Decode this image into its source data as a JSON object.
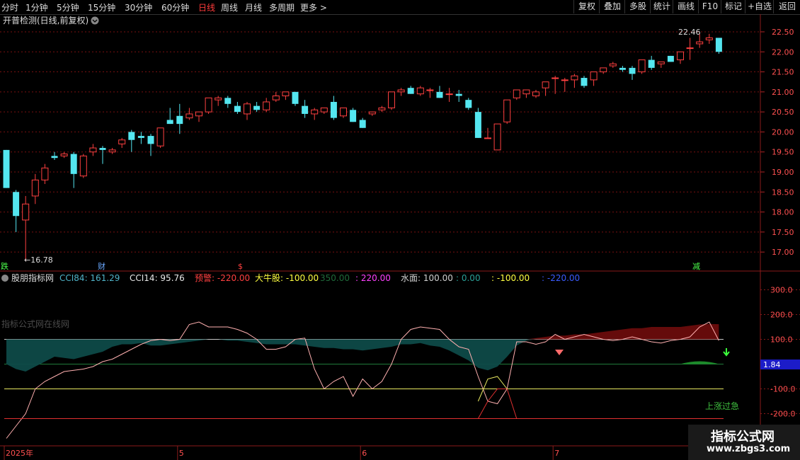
{
  "toolbar": {
    "tabs": [
      "分时",
      "1分钟",
      "5分钟",
      "15分钟",
      "30分钟",
      "60分钟",
      "日线",
      "周线",
      "月线",
      "多周期",
      "更多 >"
    ],
    "active_tab": "日线",
    "right_buttons": [
      "复权",
      "叠加",
      "多股",
      "统计",
      "画线",
      "F10",
      "标记",
      "+自选",
      "返回"
    ]
  },
  "main_panel": {
    "title": "开普检测(日线,前复权)",
    "high_label": "22.46",
    "low_label": "←16.78",
    "markers": {
      "die": "跌",
      "cai": "财",
      "dollar": "$",
      "jian": "减"
    }
  },
  "indicator_panel": {
    "name": "股朋指标网",
    "items": [
      {
        "text": "CCI84: 161.29",
        "color": "#4fb3c8"
      },
      {
        "text": "CCI14: 95.76",
        "color": "#e8e8e8"
      },
      {
        "text": "预警: -220.00",
        "color": "#ff4040"
      },
      {
        "text": "大牛股: -100.00",
        "color": "#ffff40"
      },
      {
        "text": "350.00",
        "color": "#1f6b3a"
      },
      {
        "text": ": 220.00",
        "color": "#ff40ff"
      },
      {
        "text": "水面: 100.00",
        "color": "#d0d0d0"
      },
      {
        "text": ": 0.00",
        "color": "#2aa198"
      },
      {
        "text": ": -100.00",
        "color": "#ffff40"
      },
      {
        "text": ": -220.00",
        "color": "#3a5cff"
      }
    ],
    "site_watermark": "指标公式网在线网",
    "up_text": "上涨过急",
    "value_box": "1.84"
  },
  "watermark": {
    "line1": "指标公式网",
    "line2": "www.zbgs3.com"
  },
  "colors": {
    "up": "#ff4040",
    "down": "#54e6f0",
    "bg": "#000000",
    "grid": "#7a1010"
  },
  "chart_data": {
    "type": "candlestick",
    "price_axis": {
      "ticks": [
        17.0,
        17.5,
        18.0,
        18.5,
        19.0,
        19.5,
        20.0,
        20.5,
        21.0,
        21.5,
        22.0,
        22.5
      ],
      "range": [
        16.72,
        22.8
      ]
    },
    "indicator_axis": {
      "ticks": [
        300,
        200,
        100,
        0,
        -100,
        -200
      ],
      "labels": [
        "300.0",
        "200.0",
        "100.0",
        "0.00",
        "-100.0",
        "-200.0"
      ],
      "range": [
        -330,
        370
      ]
    },
    "date_labels": [
      {
        "label": "2025年",
        "index": 0
      },
      {
        "label": "5",
        "index": 18
      },
      {
        "label": "6",
        "index": 37
      },
      {
        "label": "7",
        "index": 57
      }
    ],
    "candles": [
      [
        19.55,
        19.55,
        18.6,
        18.6
      ],
      [
        18.5,
        18.55,
        17.5,
        17.9
      ],
      [
        17.8,
        18.4,
        16.78,
        18.2
      ],
      [
        18.4,
        18.95,
        18.2,
        18.8
      ],
      [
        18.8,
        19.2,
        18.7,
        19.1
      ],
      [
        19.4,
        19.5,
        19.3,
        19.35
      ],
      [
        19.4,
        19.5,
        19.35,
        19.45
      ],
      [
        19.45,
        19.5,
        18.6,
        18.95
      ],
      [
        18.9,
        19.45,
        18.85,
        19.4
      ],
      [
        19.5,
        19.7,
        19.4,
        19.6
      ],
      [
        19.6,
        19.65,
        19.2,
        19.55
      ],
      [
        19.5,
        19.6,
        19.45,
        19.55
      ],
      [
        19.7,
        19.85,
        19.6,
        19.8
      ],
      [
        20.0,
        20.05,
        19.5,
        19.8
      ],
      [
        19.9,
        20.0,
        19.7,
        19.85
      ],
      [
        19.9,
        19.95,
        19.4,
        19.7
      ],
      [
        19.65,
        20.1,
        19.6,
        20.1
      ],
      [
        20.3,
        20.6,
        20.2,
        20.2
      ],
      [
        20.4,
        20.7,
        19.95,
        20.2
      ],
      [
        20.35,
        20.6,
        20.3,
        20.45
      ],
      [
        20.4,
        20.5,
        20.25,
        20.5
      ],
      [
        20.5,
        20.85,
        20.45,
        20.85
      ],
      [
        20.8,
        20.9,
        20.65,
        20.85
      ],
      [
        20.85,
        20.9,
        20.6,
        20.7
      ],
      [
        20.65,
        20.75,
        20.45,
        20.5
      ],
      [
        20.45,
        20.75,
        20.3,
        20.7
      ],
      [
        20.65,
        20.75,
        20.5,
        20.55
      ],
      [
        20.55,
        20.85,
        20.5,
        20.75
      ],
      [
        20.8,
        21.0,
        20.75,
        20.9
      ],
      [
        20.9,
        21.0,
        20.8,
        21.0
      ],
      [
        21.0,
        21.0,
        20.65,
        20.7
      ],
      [
        20.65,
        20.8,
        20.35,
        20.45
      ],
      [
        20.45,
        20.6,
        20.3,
        20.55
      ],
      [
        20.5,
        20.6,
        20.45,
        20.6
      ],
      [
        20.75,
        20.9,
        20.3,
        20.35
      ],
      [
        20.4,
        20.6,
        20.35,
        20.6
      ],
      [
        20.55,
        20.6,
        20.25,
        20.25
      ],
      [
        20.3,
        20.35,
        20.1,
        20.1
      ],
      [
        20.45,
        20.5,
        20.4,
        20.5
      ],
      [
        20.55,
        20.65,
        20.5,
        20.6
      ],
      [
        20.6,
        21.0,
        20.55,
        21.0
      ],
      [
        21.0,
        21.1,
        20.9,
        21.05
      ],
      [
        21.1,
        21.15,
        20.95,
        20.95
      ],
      [
        20.95,
        21.15,
        20.9,
        21.1
      ],
      [
        21.05,
        21.1,
        20.85,
        21.05
      ],
      [
        21.0,
        21.15,
        20.85,
        20.85
      ],
      [
        20.95,
        21.1,
        20.75,
        20.95
      ],
      [
        20.95,
        21.05,
        20.75,
        20.9
      ],
      [
        20.8,
        20.85,
        20.55,
        20.6
      ],
      [
        20.5,
        20.6,
        19.85,
        19.85
      ],
      [
        19.85,
        20.1,
        19.85,
        19.85
      ],
      [
        19.55,
        20.2,
        19.55,
        20.2
      ],
      [
        20.25,
        20.8,
        20.2,
        20.8
      ],
      [
        20.85,
        21.05,
        20.8,
        21.05
      ],
      [
        20.95,
        21.05,
        20.85,
        21.05
      ],
      [
        20.9,
        21.05,
        20.85,
        21.0
      ],
      [
        21.1,
        21.25,
        20.9,
        21.25
      ],
      [
        21.35,
        21.4,
        20.95,
        21.35
      ],
      [
        21.3,
        21.35,
        21.0,
        21.3
      ],
      [
        21.3,
        21.45,
        21.1,
        21.4
      ],
      [
        21.35,
        21.4,
        21.1,
        21.15
      ],
      [
        21.3,
        21.5,
        21.15,
        21.5
      ],
      [
        21.5,
        21.6,
        21.45,
        21.6
      ],
      [
        21.65,
        21.75,
        21.6,
        21.7
      ],
      [
        21.6,
        21.65,
        21.5,
        21.55
      ],
      [
        21.6,
        21.65,
        21.3,
        21.45
      ],
      [
        21.5,
        21.8,
        21.45,
        21.8
      ],
      [
        21.8,
        21.9,
        21.55,
        21.6
      ],
      [
        21.7,
        21.75,
        21.6,
        21.75
      ],
      [
        21.9,
        21.9,
        21.75,
        21.75
      ],
      [
        21.8,
        22.0,
        21.7,
        22.0
      ],
      [
        22.1,
        22.35,
        21.8,
        22.1
      ],
      [
        22.2,
        22.46,
        22.1,
        22.25
      ],
      [
        22.3,
        22.45,
        22.2,
        22.35
      ],
      [
        22.35,
        22.35,
        21.95,
        22.0
      ]
    ],
    "series": [
      {
        "name": "CCI84",
        "values": [
          0,
          -20,
          -30,
          -10,
          10,
          30,
          25,
          20,
          30,
          40,
          50,
          70,
          80,
          80,
          85,
          75,
          75,
          80,
          85,
          90,
          95,
          100,
          100,
          95,
          95,
          90,
          85,
          80,
          80,
          80,
          80,
          75,
          70,
          65,
          65,
          60,
          60,
          55,
          60,
          65,
          70,
          80,
          80,
          85,
          75,
          70,
          55,
          35,
          15,
          -15,
          -25,
          -10,
          30,
          75,
          95,
          105,
          110,
          115,
          115,
          120,
          120,
          125,
          130,
          135,
          140,
          145,
          145,
          150,
          150,
          150,
          150,
          155,
          160,
          162,
          161
        ]
      },
      {
        "name": "CCI14",
        "values": [
          -300,
          -250,
          -200,
          -100,
          -70,
          -50,
          -30,
          -25,
          -20,
          -10,
          10,
          20,
          40,
          60,
          80,
          95,
          100,
          95,
          100,
          160,
          170,
          150,
          150,
          150,
          140,
          125,
          100,
          60,
          60,
          70,
          100,
          105,
          -20,
          -100,
          -70,
          -50,
          -130,
          -60,
          -100,
          -70,
          0,
          100,
          140,
          150,
          145,
          140,
          100,
          70,
          60,
          -50,
          -150,
          -160,
          -100,
          90,
          90,
          80,
          90,
          120,
          100,
          110,
          120,
          110,
          100,
          95,
          100,
          110,
          100,
          90,
          85,
          95,
          100,
          110,
          150,
          170,
          95
        ]
      },
      {
        "name": "预警",
        "values": [
          -220,
          -220,
          -220,
          -220,
          -220,
          -220,
          -220,
          -220,
          -220,
          -220,
          -220,
          -220,
          -220,
          -220,
          -220,
          -220,
          -220,
          -220,
          -220,
          -220,
          -220,
          -220,
          -220,
          -220,
          -220,
          -220,
          -220,
          -220,
          -220,
          -220,
          -220,
          -220,
          -220,
          -220,
          -220,
          -220,
          -220,
          -220,
          -220,
          -220,
          -220,
          -220,
          -220,
          -220,
          -220,
          -220,
          -220,
          -220,
          -220,
          -220,
          -150,
          -100,
          -100,
          -220,
          -220,
          -220,
          -220,
          -220,
          -220,
          -220,
          -220,
          -220,
          -220,
          -220,
          -220,
          -220,
          -220,
          -220,
          -220,
          -220,
          -220,
          -220,
          -220,
          -220,
          -220
        ]
      }
    ],
    "reference_lines": [
      {
        "name": "水面",
        "value": 100
      },
      {
        "value": 0
      },
      {
        "value": -100
      },
      {
        "value": -220
      }
    ]
  }
}
